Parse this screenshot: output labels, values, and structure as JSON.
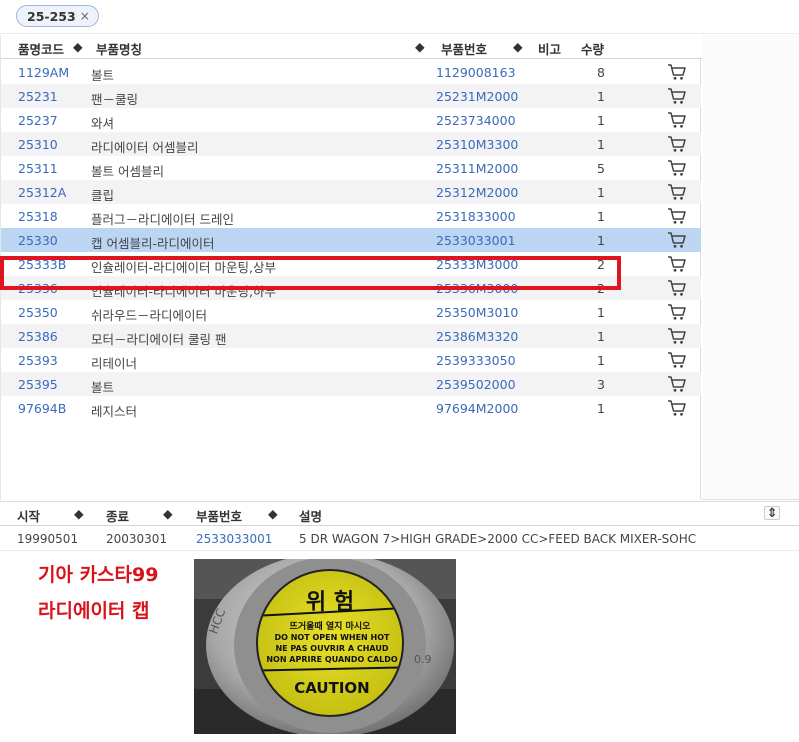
{
  "filter": {
    "chip_label": "25-253",
    "remove_glyph": "×"
  },
  "parts_table": {
    "columns": {
      "code": "품명코드",
      "name": "부품명칭",
      "part_no": "부품번호",
      "note": "비고",
      "qty": "수량"
    },
    "rows": [
      {
        "code": "1129AM",
        "name": "볼트",
        "part_no": "1129008163",
        "qty": "8"
      },
      {
        "code": "25231",
        "name": "팬－쿨링",
        "part_no": "25231M2000",
        "qty": "1"
      },
      {
        "code": "25237",
        "name": "와셔",
        "part_no": "2523734000",
        "qty": "1"
      },
      {
        "code": "25310",
        "name": "라디에이터 어셈블리",
        "part_no": "25310M3300",
        "qty": "1"
      },
      {
        "code": "25311",
        "name": "볼트 어셈블리",
        "part_no": "25311M2000",
        "qty": "5"
      },
      {
        "code": "25312A",
        "name": "클립",
        "part_no": "25312M2000",
        "qty": "1"
      },
      {
        "code": "25318",
        "name": "플러그－라디에이터 드레인",
        "part_no": "2531833000",
        "qty": "1"
      },
      {
        "code": "25330",
        "name": "캡 어셈블리-라디에이터",
        "part_no": "2533033001",
        "qty": "1"
      },
      {
        "code": "25333B",
        "name": "인슐레이터-라디에이터 마운팅,상부",
        "part_no": "25333M3000",
        "qty": "2"
      },
      {
        "code": "25336",
        "name": "인슐레이터-라디에이터 마운팅,하부",
        "part_no": "25336M3000",
        "qty": "2"
      },
      {
        "code": "25350",
        "name": "쉬라우드－라디에이터",
        "part_no": "25350M3010",
        "qty": "1"
      },
      {
        "code": "25386",
        "name": "모터－라디에이터 쿨링 팬",
        "part_no": "25386M3320",
        "qty": "1"
      },
      {
        "code": "25393",
        "name": "리테이너",
        "part_no": "2539333050",
        "qty": "1"
      },
      {
        "code": "25395",
        "name": "볼트",
        "part_no": "2539502000",
        "qty": "3"
      },
      {
        "code": "97694B",
        "name": "레지스터",
        "part_no": "97694M2000",
        "qty": "1"
      }
    ],
    "selected_index": 7,
    "cart_icon": "shopping-cart-icon"
  },
  "detail_table": {
    "columns": {
      "start": "시작",
      "end": "종료",
      "part_no": "부품번호",
      "desc": "설명"
    },
    "row": {
      "start": "19990501",
      "end": "20030301",
      "part_no": "2533033001",
      "desc": "5 DR WAGON 7>HIGH GRADE>2000 CC>FEED BACK MIXER-SOHC"
    }
  },
  "annotation": {
    "line1": "기아 카스타99",
    "line2": "라디에이터 캡"
  },
  "photo": {
    "cap_warning_big": "위 험",
    "cap_warning_korean": "뜨거울때 열지 마시오",
    "cap_text_en": "DO NOT OPEN WHEN HOT",
    "cap_text_fr": "NE PAS OUVRIR A CHAUD",
    "cap_text_es": "NON APRIRE QUANDO CALDO",
    "cap_caution": "CAUTION",
    "cap_brand": "HCC",
    "cap_rating": "0.9"
  },
  "colors": {
    "accent_link": "#3a6ab8",
    "selected_row": "#bcd5f3",
    "highlight_box": "#e0141e",
    "annotation_red": "#d8131b"
  }
}
